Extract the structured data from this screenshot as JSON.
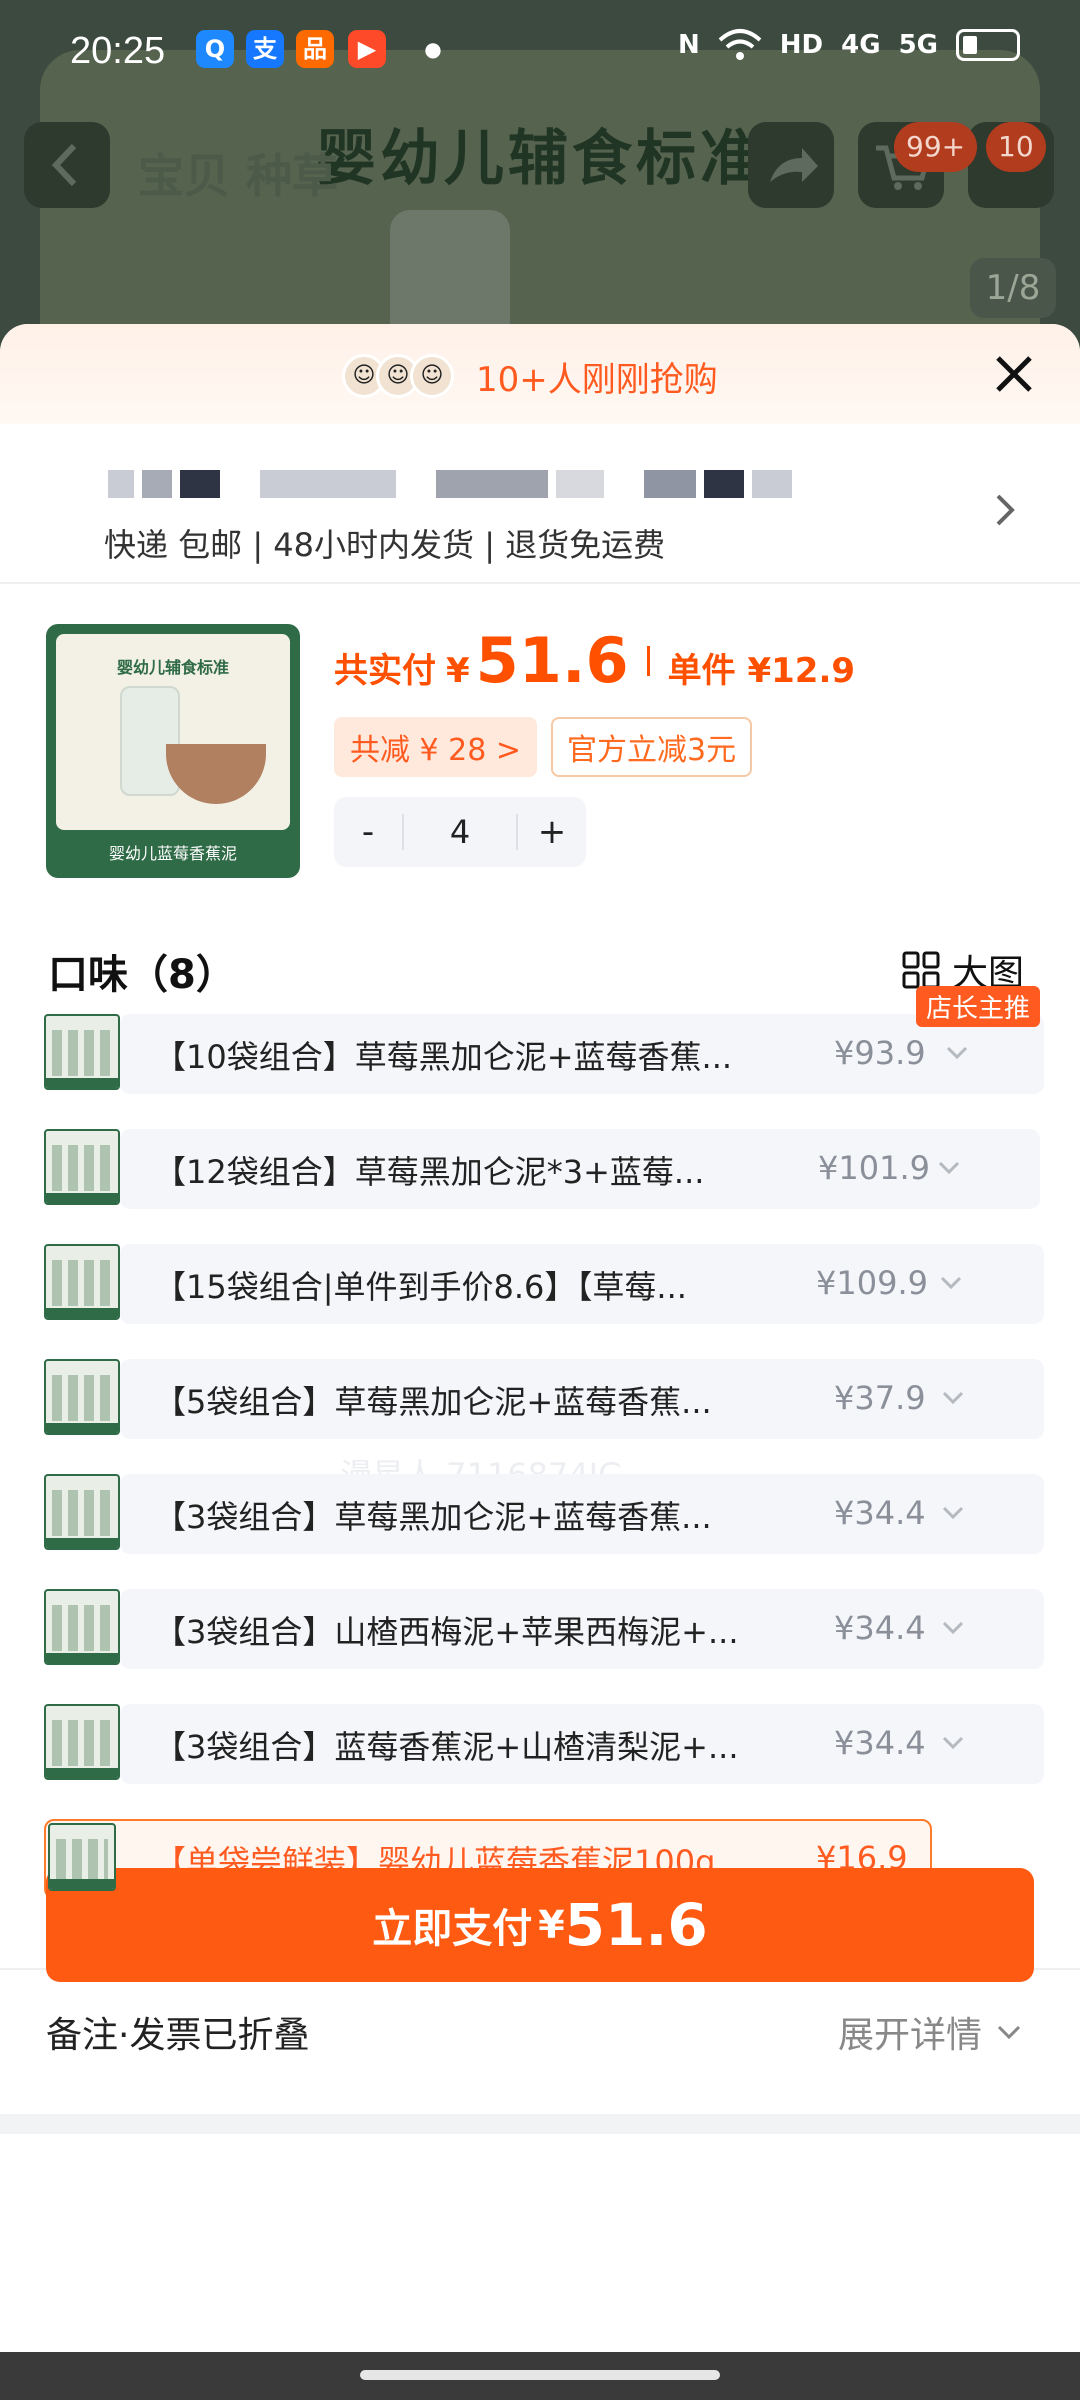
{
  "status_bar": {
    "time": "20:25",
    "net_labels": [
      "HD",
      "4G",
      "5G"
    ],
    "apps": [
      {
        "icon": "search-app-icon",
        "glyph": "Q",
        "color": "#1e88ff"
      },
      {
        "icon": "alipay-app-icon",
        "glyph": "支",
        "color": "#1677ff"
      },
      {
        "icon": "shopping-app-icon",
        "glyph": "品",
        "color": "#ff6a00"
      },
      {
        "icon": "video-app-icon",
        "glyph": "▶",
        "color": "#ff4a2a"
      }
    ]
  },
  "background_page": {
    "title": "婴幼儿辅食标准",
    "tabs": "宝贝  种草",
    "cart_badge": "99+",
    "more_badge": "10",
    "image_index": "1/8"
  },
  "promo": {
    "text": "10+人刚刚抢购"
  },
  "shipping": {
    "text": "快递 包邮 | 48小时内发货 | 退货免运费"
  },
  "product": {
    "image_title": "婴幼儿辅食标准",
    "image_caption": "婴幼儿蓝莓香蕉泥",
    "total_label": "共实付",
    "total_currency": "¥",
    "total_amount": "51.6",
    "unit_label": "单件 ¥12.9",
    "discount_tag": "共减 ¥ 28 >",
    "official_tag": "官方立减3元",
    "quantity": "4",
    "minus": "-",
    "plus": "+"
  },
  "flavors": {
    "header": "口味（8）",
    "big_image_label": "大图",
    "recommend_badge": "店长主推",
    "items": [
      {
        "name": "【10袋组合】草莓黑加仑泥+蓝莓香蕉...",
        "price": "¥93.9"
      },
      {
        "name": "【12袋组合】草莓黑加仑泥*3+蓝莓...",
        "price": "¥101.9"
      },
      {
        "name": "【15袋组合|单件到手价8.6】【草莓...",
        "price": "¥109.9"
      },
      {
        "name": "【5袋组合】草莓黑加仑泥+蓝莓香蕉...",
        "price": "¥37.9"
      },
      {
        "name": "【3袋组合】草莓黑加仑泥+蓝莓香蕉...",
        "price": "¥34.4"
      },
      {
        "name": "【3袋组合】山楂西梅泥+苹果西梅泥+...",
        "price": "¥34.4"
      },
      {
        "name": "【3袋组合】蓝莓香蕉泥+山楂清梨泥+...",
        "price": "¥34.4"
      },
      {
        "name": "【单袋尝鲜装】婴幼儿蓝莓香蕉泥100g",
        "price": "¥16.9"
      }
    ]
  },
  "watermark": "漫星人 7116874JG",
  "memo": {
    "left": "备注·发票已折叠",
    "right": "展开详情"
  },
  "pay": {
    "label": "立即支付",
    "currency": "¥",
    "amount": "51.6"
  }
}
